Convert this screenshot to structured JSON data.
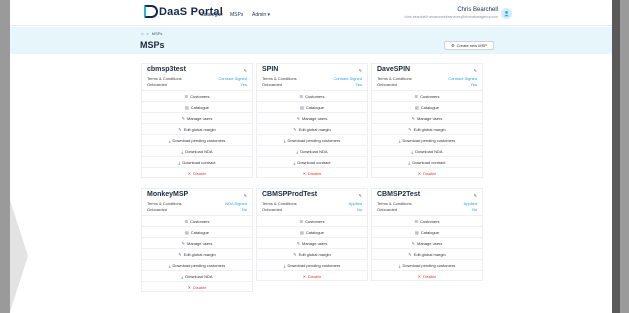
{
  "app": {
    "logo": "DaaS Portal",
    "nav": [
      "Catalogue",
      "MSPs",
      "Admin ▾"
    ]
  },
  "user": {
    "name": "Chris Bearchell",
    "email": "chris.bearchell+amazonwebservices@ntcreativeagency.com"
  },
  "breadcrumb": {
    "home_icon": "home-icon",
    "sep": ">",
    "current": "MSPs"
  },
  "page": {
    "title": "MSPs",
    "new_button": "Create new MSP"
  },
  "labels": {
    "terms": "Terms & Conditions",
    "onboarded": "Onboarded"
  },
  "cards": [
    {
      "name": "cbmsp3test",
      "terms": "Contract Signed",
      "onboarded": "Yes",
      "actions": [
        "Customers",
        "Catalogue",
        "Manage users",
        "Edit global margin",
        "Download pending customers",
        "Download NDA",
        "Download contract",
        "Disable"
      ]
    },
    {
      "name": "SPIN",
      "terms": "Contract Signed",
      "onboarded": "Yes",
      "actions": [
        "Customers",
        "Catalogue",
        "Manage users",
        "Edit global margin",
        "Download pending customers",
        "Download NDA",
        "Download contract",
        "Disable"
      ]
    },
    {
      "name": "DaveSPIN",
      "terms": "Contract Signed",
      "onboarded": "Yes",
      "actions": [
        "Customers",
        "Catalogue",
        "Manage users",
        "Edit global margin",
        "Download pending customers",
        "Download NDA",
        "Download contract",
        "Disable"
      ]
    },
    {
      "name": "MonkeyMSP",
      "terms": "NDA Signed",
      "onboarded": "No",
      "actions": [
        "Customers",
        "Catalogue",
        "Manage users",
        "Edit global margin",
        "Download pending customers",
        "Download NDA",
        "Disable"
      ]
    },
    {
      "name": "CBMSPProdTest",
      "terms": "Applied",
      "onboarded": "No",
      "actions": [
        "Customers",
        "Catalogue",
        "Manage users",
        "Edit global margin",
        "Download pending customers",
        "Disable"
      ]
    },
    {
      "name": "CBMSP2Test",
      "terms": "Applied",
      "onboarded": "No",
      "actions": [
        "Customers",
        "Catalogue",
        "Manage users",
        "Edit global margin",
        "Download pending customers",
        "Disable"
      ]
    }
  ],
  "action_icons": {
    "Customers": "☰",
    "Catalogue": "▤",
    "Manage users": "✎",
    "Edit global margin": "✎",
    "Download pending customers": "⤓",
    "Download NDA": "⤓",
    "Download contract": "⤓",
    "Disable": "✕"
  }
}
